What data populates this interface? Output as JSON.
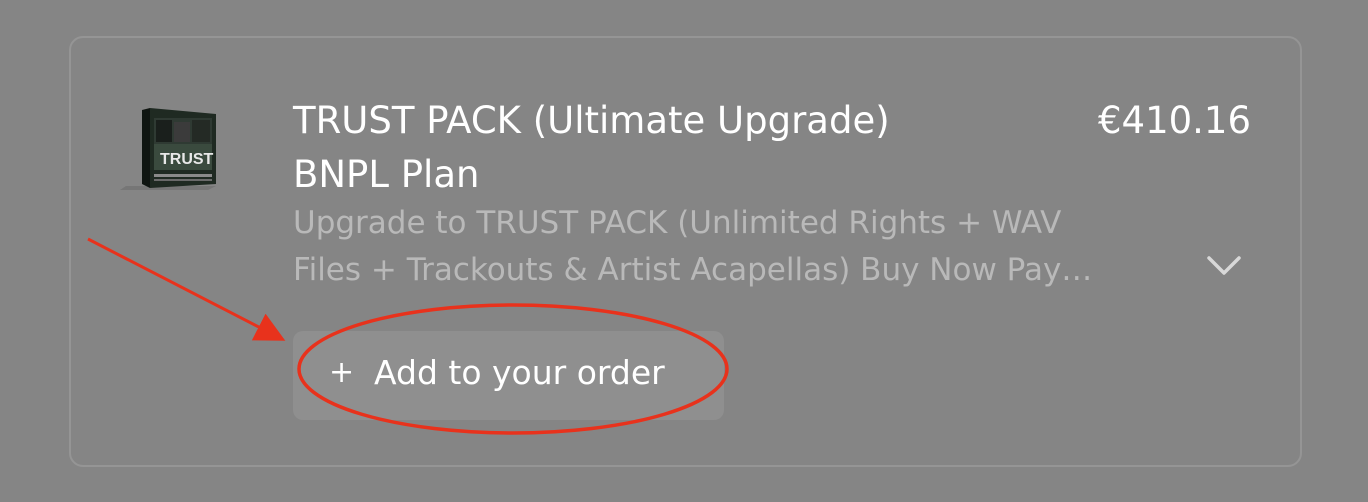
{
  "product": {
    "title_line1": "TRUST PACK (Ultimate Upgrade)",
    "title_line2": "BNPL Plan",
    "price": "€410.16",
    "description_line1": "Upgrade to TRUST PACK (Unlimited Rights + WAV",
    "description_line2": "Files + Trackouts & Artist Acapellas) Buy Now Pay…",
    "thumbnail_text": "TRUST",
    "expand_icon": "chevron-down-icon"
  },
  "add_button": {
    "icon": "+",
    "label": "Add to your order"
  },
  "annotation": {
    "color": "#e8321c"
  },
  "colors": {
    "background": "#858585",
    "title": "#ffffff",
    "description": "#b9b9b9",
    "button_bg": "#8f8f8f"
  }
}
